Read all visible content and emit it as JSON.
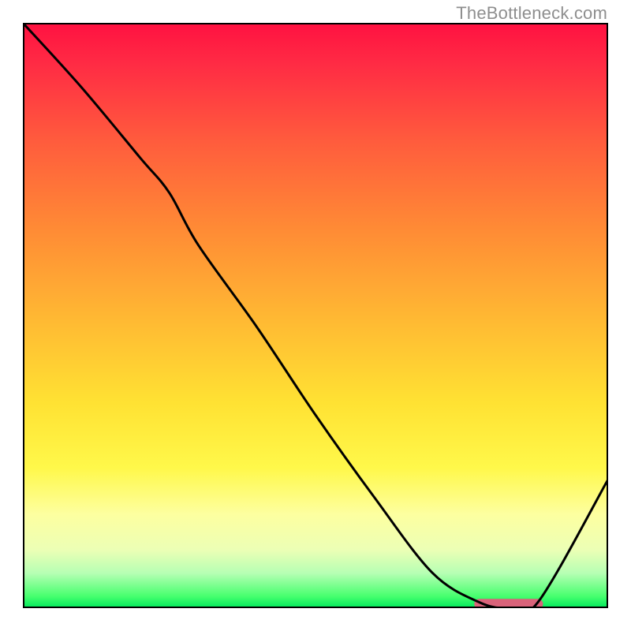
{
  "watermark": "TheBottleneck.com",
  "chart_data": {
    "type": "line",
    "title": "",
    "xlabel": "",
    "ylabel": "",
    "xlim": [
      0,
      100
    ],
    "ylim": [
      0,
      100
    ],
    "grid": false,
    "series": [
      {
        "name": "curve",
        "x": [
          0,
          10,
          20,
          25,
          30,
          40,
          50,
          60,
          70,
          78,
          83,
          88,
          100
        ],
        "y": [
          100,
          89,
          77,
          71,
          62,
          48,
          33,
          19,
          6,
          1,
          0,
          1,
          22
        ]
      }
    ],
    "marker": {
      "name": "floor-segment",
      "x_start": 78,
      "x_end": 88,
      "y": 0.7,
      "color": "#d9637a"
    },
    "background_gradient": {
      "type": "vertical",
      "stops": [
        {
          "pos": 0.0,
          "color": "#ff1141"
        },
        {
          "pos": 0.2,
          "color": "#ff5b3d"
        },
        {
          "pos": 0.5,
          "color": "#ffb733"
        },
        {
          "pos": 0.76,
          "color": "#fff84a"
        },
        {
          "pos": 0.94,
          "color": "#b7ffb4"
        },
        {
          "pos": 1.0,
          "color": "#00e85c"
        }
      ]
    }
  }
}
